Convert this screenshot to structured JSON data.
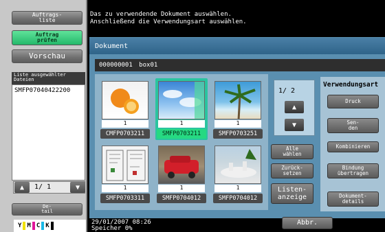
{
  "left_panel": {
    "auftragsliste": "Auftrags-\nliste",
    "auftrag_pruefen": "Auftrag\nprüfen",
    "vorschau": "Vorschau",
    "selected_files_header": "Liste ausgewählter\nDateien",
    "selected_file": "SMFP07040422200",
    "pager": "1/ 1",
    "detail": "De-\ntail",
    "toner": [
      "Y",
      "M",
      "C",
      "K"
    ],
    "toner_colors": [
      "#f2e200",
      "#e0169a",
      "#19b8e6",
      "#000000"
    ]
  },
  "message": "Das zu verwendende Dokument auswählen.\nAnschließend die Verwendungsart auswählen.",
  "document": {
    "title": "Dokument",
    "box_path": "000000001 box01"
  },
  "thumbnails": [
    {
      "count": "1",
      "name": "CMFP0703211",
      "selected": false
    },
    {
      "count": "1",
      "name": "SMFP0703211",
      "selected": true
    },
    {
      "count": "1",
      "name": "SMFP0703251",
      "selected": false
    },
    {
      "count": "1",
      "name": "SMFP0703311",
      "selected": false
    },
    {
      "count": "1",
      "name": "SMFP0704012",
      "selected": false
    },
    {
      "count": "1",
      "name": "SMFP0704012",
      "selected": false
    }
  ],
  "pager": {
    "text": "1/ 2",
    "up": "▲",
    "down": "▼"
  },
  "buttons": {
    "alle_waehlen": "Alle\nwählen",
    "zuruecksetzen": "Zurück-\nsetzen",
    "listenanzeige": "Listen-\nanzeige"
  },
  "verwendungsart": {
    "title": "Verwendungsart",
    "druck": "Druck",
    "senden": "Sen-\nden",
    "kombinieren": "Kombinieren",
    "bindung": "Bindung\nübertragen",
    "dokumentdetails": "Dokument-\ndetails"
  },
  "status": {
    "date": "29/01/2007   08:26\nSpeicher        0%",
    "abbr": "Abbr."
  }
}
